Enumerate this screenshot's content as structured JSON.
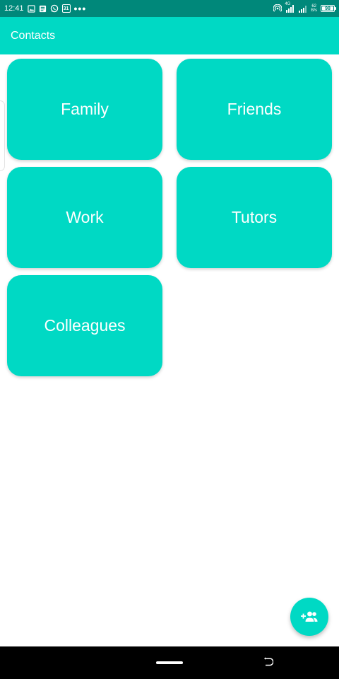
{
  "status_bar": {
    "time": "12:41",
    "icons": [
      "gallery-icon",
      "news-icon",
      "whatsapp-icon",
      "calendar-icon",
      "more-icon",
      "hotspot-icon",
      "signal-icon",
      "signal-icon-2",
      "battery-icon"
    ],
    "calendar_day": "31",
    "more": "•••",
    "net_speed_value": "62",
    "net_speed_unit": "B/s",
    "network_type": "4G",
    "battery_level": "98"
  },
  "app_bar": {
    "title": "Contacts"
  },
  "groups": [
    {
      "label": "Family"
    },
    {
      "label": "Friends"
    },
    {
      "label": "Work"
    },
    {
      "label": "Tutors"
    },
    {
      "label": "Colleagues"
    }
  ],
  "fab": {
    "icon": "add-group-icon"
  },
  "colors": {
    "status_bar": "#00887a",
    "accent": "#00d9c4",
    "text_on_accent": "#ffffff",
    "nav_bar": "#000000"
  }
}
